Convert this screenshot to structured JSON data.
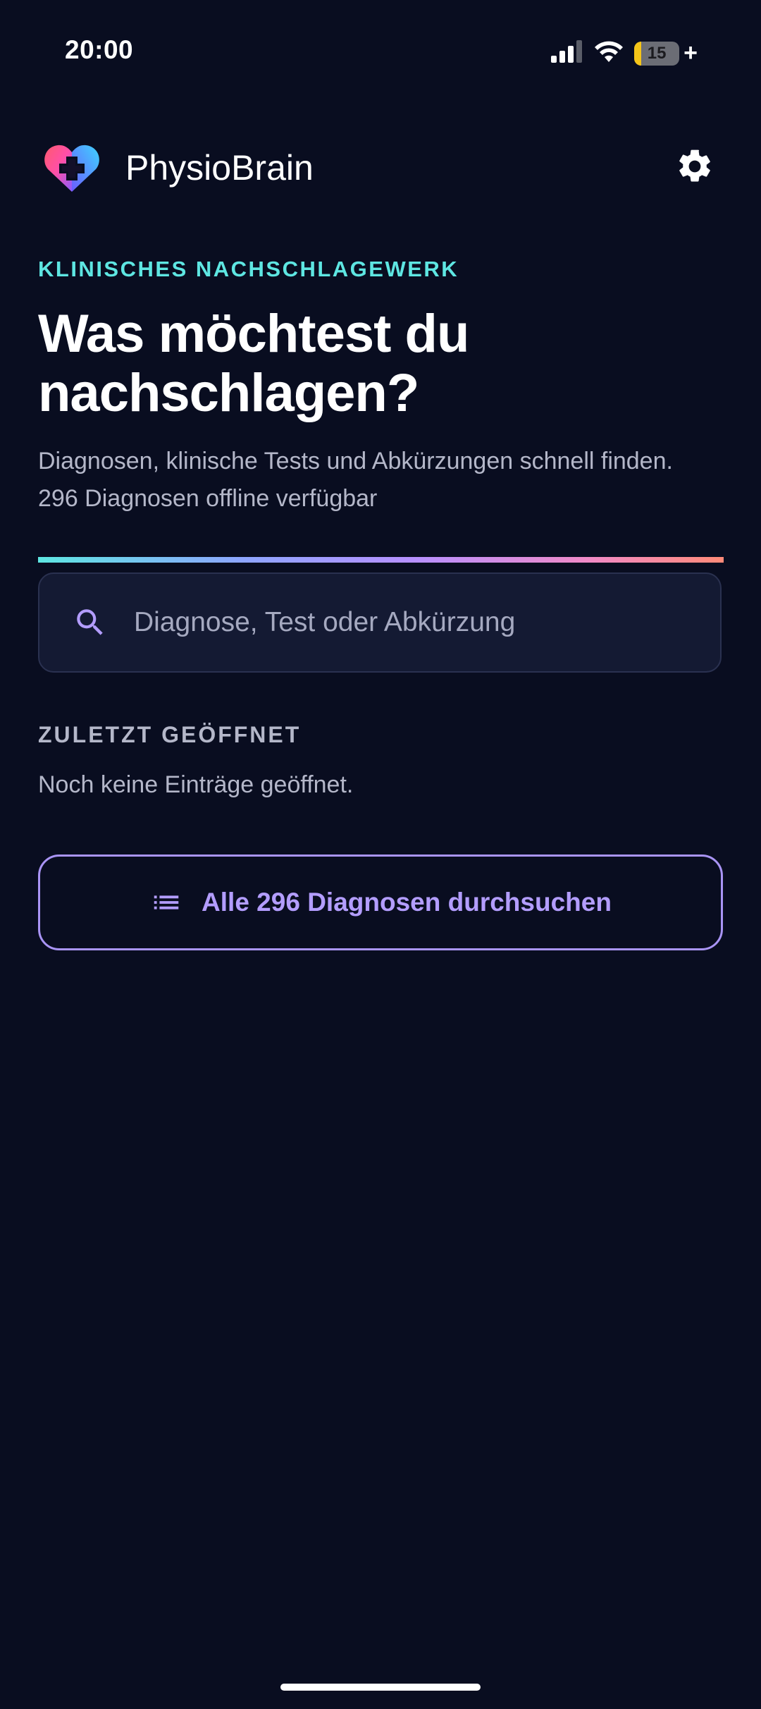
{
  "status_bar": {
    "time": "20:00",
    "battery_level": "15",
    "signal_icon": "cellular-signal-icon",
    "wifi_icon": "wifi-icon",
    "battery_icon": "battery-charging-icon"
  },
  "header": {
    "app_name": "PhysioBrain",
    "logo_icon": "heart-cross-logo-icon",
    "settings_icon": "gear-icon"
  },
  "hero": {
    "eyebrow": "KLINISCHES NACHSCHLAGEWERK",
    "headline_line1": "Was möchtest du",
    "headline_line2": "nachschlagen?",
    "subtitle_line1": "Diagnosen, klinische Tests und Abkürzungen schnell finden.",
    "subtitle_line2": "296 Diagnosen offline verfügbar"
  },
  "search": {
    "placeholder": "Diagnose, Test oder Abkürzung",
    "value": "",
    "icon": "search-icon"
  },
  "recent": {
    "label": "ZULETZT GEÖFFNET",
    "empty_text": "Noch keine Einträge geöffnet."
  },
  "browse": {
    "label": "Alle 296 Diagnosen durchsuchen",
    "icon": "list-icon"
  },
  "colors": {
    "background": "#090d20",
    "accent_teal": "#5ee6e2",
    "accent_purple": "#b39dff",
    "muted_text": "#b4b7c9",
    "search_bg": "#141a33",
    "battery_yellow": "#f5c518"
  }
}
